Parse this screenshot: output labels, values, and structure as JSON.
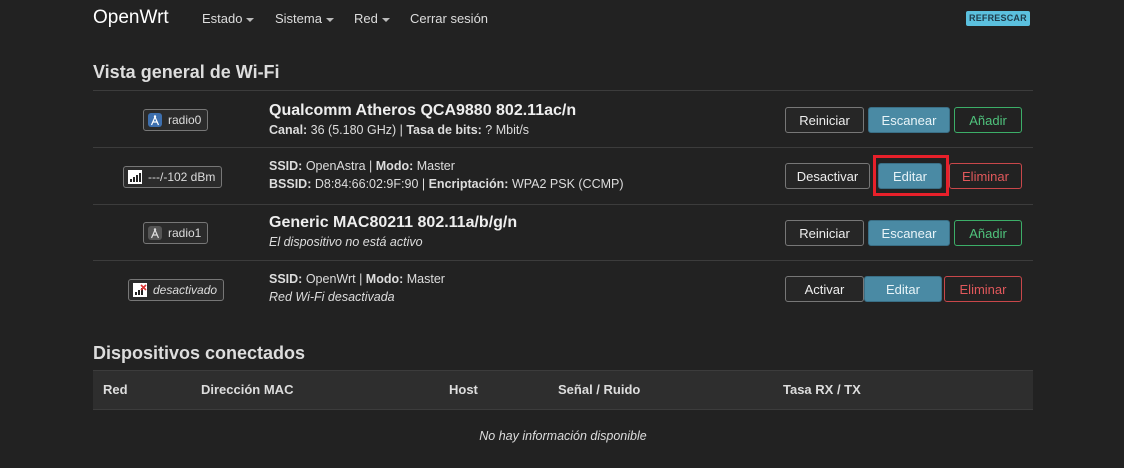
{
  "nav": {
    "brand": "OpenWrt",
    "menu": [
      "Estado",
      "Sistema",
      "Red",
      "Cerrar sesión"
    ],
    "refresh_label": "REFRESCAR"
  },
  "wifi": {
    "heading": "Vista general de Wi-Fi",
    "rows": [
      {
        "badge": "radio0",
        "title": "Qualcomm Atheros QCA9880 802.11ac/n",
        "line1_label": "Canal:",
        "line1_value": " 36 (5.180 GHz) | ",
        "line1_label2": "Tasa de bits:",
        "line1_value2": " ? Mbit/s",
        "buttons": [
          "Reiniciar",
          "Escanear",
          "Añadir"
        ]
      },
      {
        "badge": "---/-102 dBm",
        "ssid_label": "SSID:",
        "ssid_value": " OpenAstra | ",
        "mode_label": "Modo:",
        "mode_value": " Master",
        "bssid_label": "BSSID:",
        "bssid_value": " D8:84:66:02:9F:90 | ",
        "enc_label": "Encriptación:",
        "enc_value": " WPA2 PSK (CCMP)",
        "buttons": [
          "Desactivar",
          "Editar",
          "Eliminar"
        ]
      },
      {
        "badge": "radio1",
        "title": "Generic MAC80211 802.11a/b/g/n",
        "subtitle": "El dispositivo no está activo",
        "buttons": [
          "Reiniciar",
          "Escanear",
          "Añadir"
        ]
      },
      {
        "badge": "desactivado",
        "ssid_label": "SSID:",
        "ssid_value": " OpenWrt | ",
        "mode_label": "Modo:",
        "mode_value": " Master",
        "subtitle": "Red Wi-Fi desactivada",
        "buttons": [
          "Activar",
          "Editar",
          "Eliminar"
        ]
      }
    ]
  },
  "clients": {
    "heading": "Dispositivos conectados",
    "columns": [
      "Red",
      "Dirección MAC",
      "Host",
      "Señal / Ruido",
      "Tasa RX / TX"
    ],
    "empty_text": "No hay información disponible"
  },
  "colors": {
    "background": "#222222",
    "primary_button": "#4a8aa4",
    "positive": "#4fc27c",
    "negative": "#e0585b",
    "highlight": "#e8202a"
  }
}
